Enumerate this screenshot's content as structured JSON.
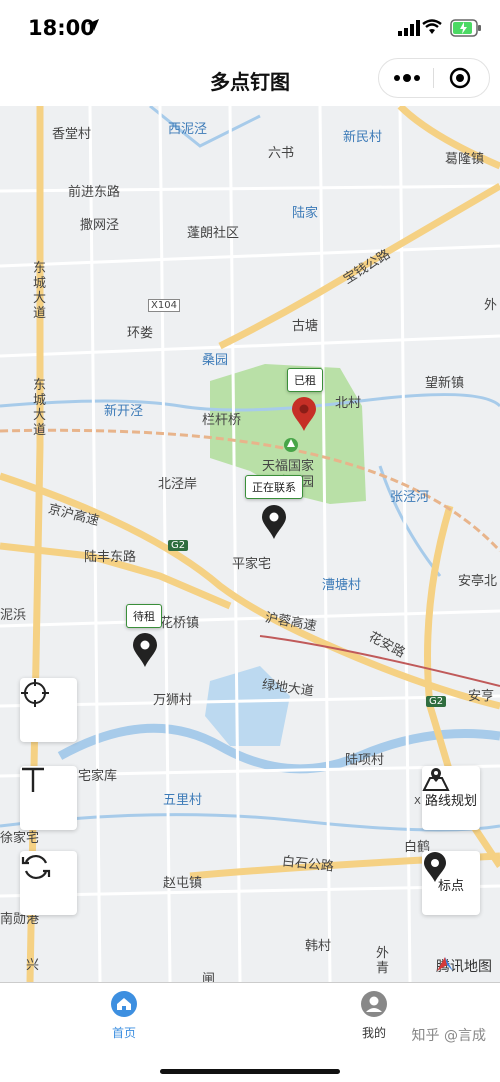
{
  "status_bar": {
    "time": "18:00"
  },
  "nav": {
    "title": "多点钉图"
  },
  "map_labels": [
    {
      "text": "香堂村",
      "style": ""
    },
    {
      "text": "西泥泾",
      "style": "blue"
    },
    {
      "text": "新民村",
      "style": "blue"
    },
    {
      "text": "葛隆镇",
      "style": ""
    },
    {
      "text": "六书",
      "style": ""
    },
    {
      "text": "前进东路",
      "style": ""
    },
    {
      "text": "陆家",
      "style": "blue"
    },
    {
      "text": "撒网泾",
      "style": ""
    },
    {
      "text": "蓬朗社区",
      "style": ""
    },
    {
      "text": "东城大道",
      "style": ""
    },
    {
      "text": "宝钱公路",
      "style": ""
    },
    {
      "text": "X104",
      "style": ""
    },
    {
      "text": "外",
      "style": ""
    },
    {
      "text": "环娄",
      "style": ""
    },
    {
      "text": "古塘",
      "style": ""
    },
    {
      "text": "桑园",
      "style": "blue"
    },
    {
      "text": "望新镇",
      "style": ""
    },
    {
      "text": "新开泾",
      "style": "blue"
    },
    {
      "text": "栏杆桥",
      "style": ""
    },
    {
      "text": "北村",
      "style": ""
    },
    {
      "text": "东城大道",
      "style": ""
    },
    {
      "text": "天福国家湿地公园",
      "style": ""
    },
    {
      "text": "北泾岸",
      "style": ""
    },
    {
      "text": "张泾河",
      "style": "blue"
    },
    {
      "text": "京沪高速",
      "style": ""
    },
    {
      "text": "陆丰东路",
      "style": ""
    },
    {
      "text": "G2",
      "style": ""
    },
    {
      "text": "平家宅",
      "style": ""
    },
    {
      "text": "安亭北",
      "style": ""
    },
    {
      "text": "漕塘村",
      "style": "blue"
    },
    {
      "text": "泥浜",
      "style": ""
    },
    {
      "text": "花桥镇",
      "style": ""
    },
    {
      "text": "沪蓉高速",
      "style": ""
    },
    {
      "text": "花安路",
      "style": ""
    },
    {
      "text": "万狮村",
      "style": ""
    },
    {
      "text": "绿地大道",
      "style": ""
    },
    {
      "text": "安亨",
      "style": ""
    },
    {
      "text": "陆项村",
      "style": ""
    },
    {
      "text": "宅家库",
      "style": ""
    },
    {
      "text": "五里村",
      "style": "blue"
    },
    {
      "text": "徐家宅",
      "style": ""
    },
    {
      "text": "白鹤",
      "style": ""
    },
    {
      "text": "白石公路",
      "style": ""
    },
    {
      "text": "赵屯镇",
      "style": ""
    },
    {
      "text": "南勋港",
      "style": ""
    },
    {
      "text": "韩村",
      "style": ""
    },
    {
      "text": "兴",
      "style": ""
    },
    {
      "text": "外青",
      "style": ""
    },
    {
      "text": "闸",
      "style": ""
    },
    {
      "text": "G2",
      "style": ""
    },
    {
      "text": "X",
      "style": ""
    }
  ],
  "pins": [
    {
      "label": "已租",
      "color": "#c62f26"
    },
    {
      "label": "正在联系",
      "color": "#222222"
    },
    {
      "label": "待租",
      "color": "#222222"
    }
  ],
  "controls": {
    "locate_icon": "crosshair-icon",
    "text_icon": "text-T-icon",
    "refresh_icon": "refresh-icon",
    "route_label": "路线规划",
    "mark_label": "标点"
  },
  "map_logo": "腾讯地图",
  "tabs": [
    {
      "label": "首页",
      "icon": "home-icon",
      "active": true,
      "color": "#3d8fe0"
    },
    {
      "label": "我的",
      "icon": "user-icon",
      "active": false,
      "color": "#333333"
    }
  ],
  "watermark": "知乎 @言成"
}
